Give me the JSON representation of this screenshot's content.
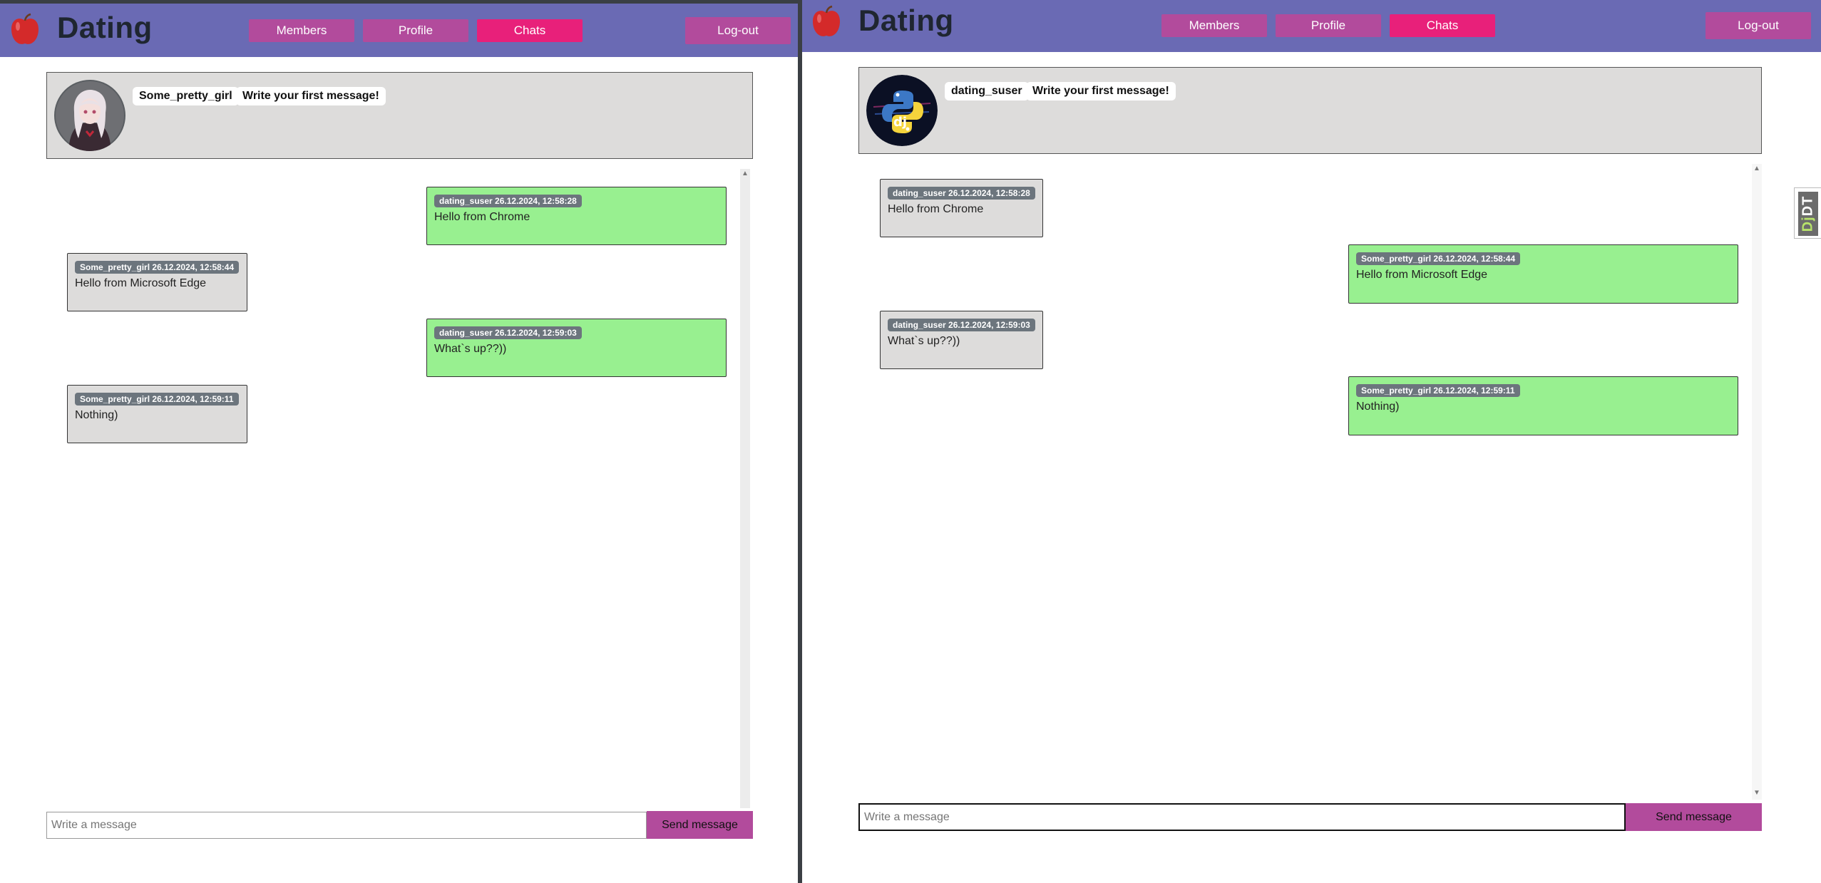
{
  "left": {
    "brand": "Dating",
    "nav": {
      "members": "Members",
      "profile": "Profile",
      "chats": "Chats",
      "logout": "Log-out"
    },
    "chat_partner": {
      "username": "Some_pretty_girl",
      "prompt": "Write your first message!"
    },
    "messages": [
      {
        "author": "dating_suser",
        "timestamp": "26.12.2024, 12:58:28",
        "text": "Hello from Chrome",
        "mine": true
      },
      {
        "author": "Some_pretty_girl",
        "timestamp": "26.12.2024, 12:58:44",
        "text": "Hello from Microsoft Edge",
        "mine": false
      },
      {
        "author": "dating_suser",
        "timestamp": "26.12.2024, 12:59:03",
        "text": "What`s up??))",
        "mine": true
      },
      {
        "author": "Some_pretty_girl",
        "timestamp": "26.12.2024, 12:59:11",
        "text": "Nothing)",
        "mine": false
      }
    ],
    "composer": {
      "placeholder": "Write a message",
      "send_label": "Send message"
    }
  },
  "right": {
    "brand": "Dating",
    "nav": {
      "members": "Members",
      "profile": "Profile",
      "chats": "Chats",
      "logout": "Log-out"
    },
    "chat_partner": {
      "username": "dating_suser",
      "prompt": "Write your first message!"
    },
    "messages": [
      {
        "author": "dating_suser",
        "timestamp": "26.12.2024, 12:58:28",
        "text": "Hello from Chrome",
        "mine": false
      },
      {
        "author": "Some_pretty_girl",
        "timestamp": "26.12.2024, 12:58:44",
        "text": "Hello from Microsoft Edge",
        "mine": true
      },
      {
        "author": "dating_suser",
        "timestamp": "26.12.2024, 12:59:03",
        "text": "What`s up??))",
        "mine": false
      },
      {
        "author": "Some_pretty_girl",
        "timestamp": "26.12.2024, 12:59:11",
        "text": "Nothing)",
        "mine": true
      }
    ],
    "composer": {
      "placeholder": "Write a message",
      "send_label": "Send message"
    },
    "debug_toolbar": {
      "label_prefix": "Dj",
      "label_suffix": "DT"
    }
  },
  "colors": {
    "navbar": "#6a6ab4",
    "nav_button": "#b24b9c",
    "nav_button_active": "#e8207a",
    "message_mine": "#98f090",
    "message_other": "#dddcdb",
    "meta_badge": "#6c757d"
  }
}
